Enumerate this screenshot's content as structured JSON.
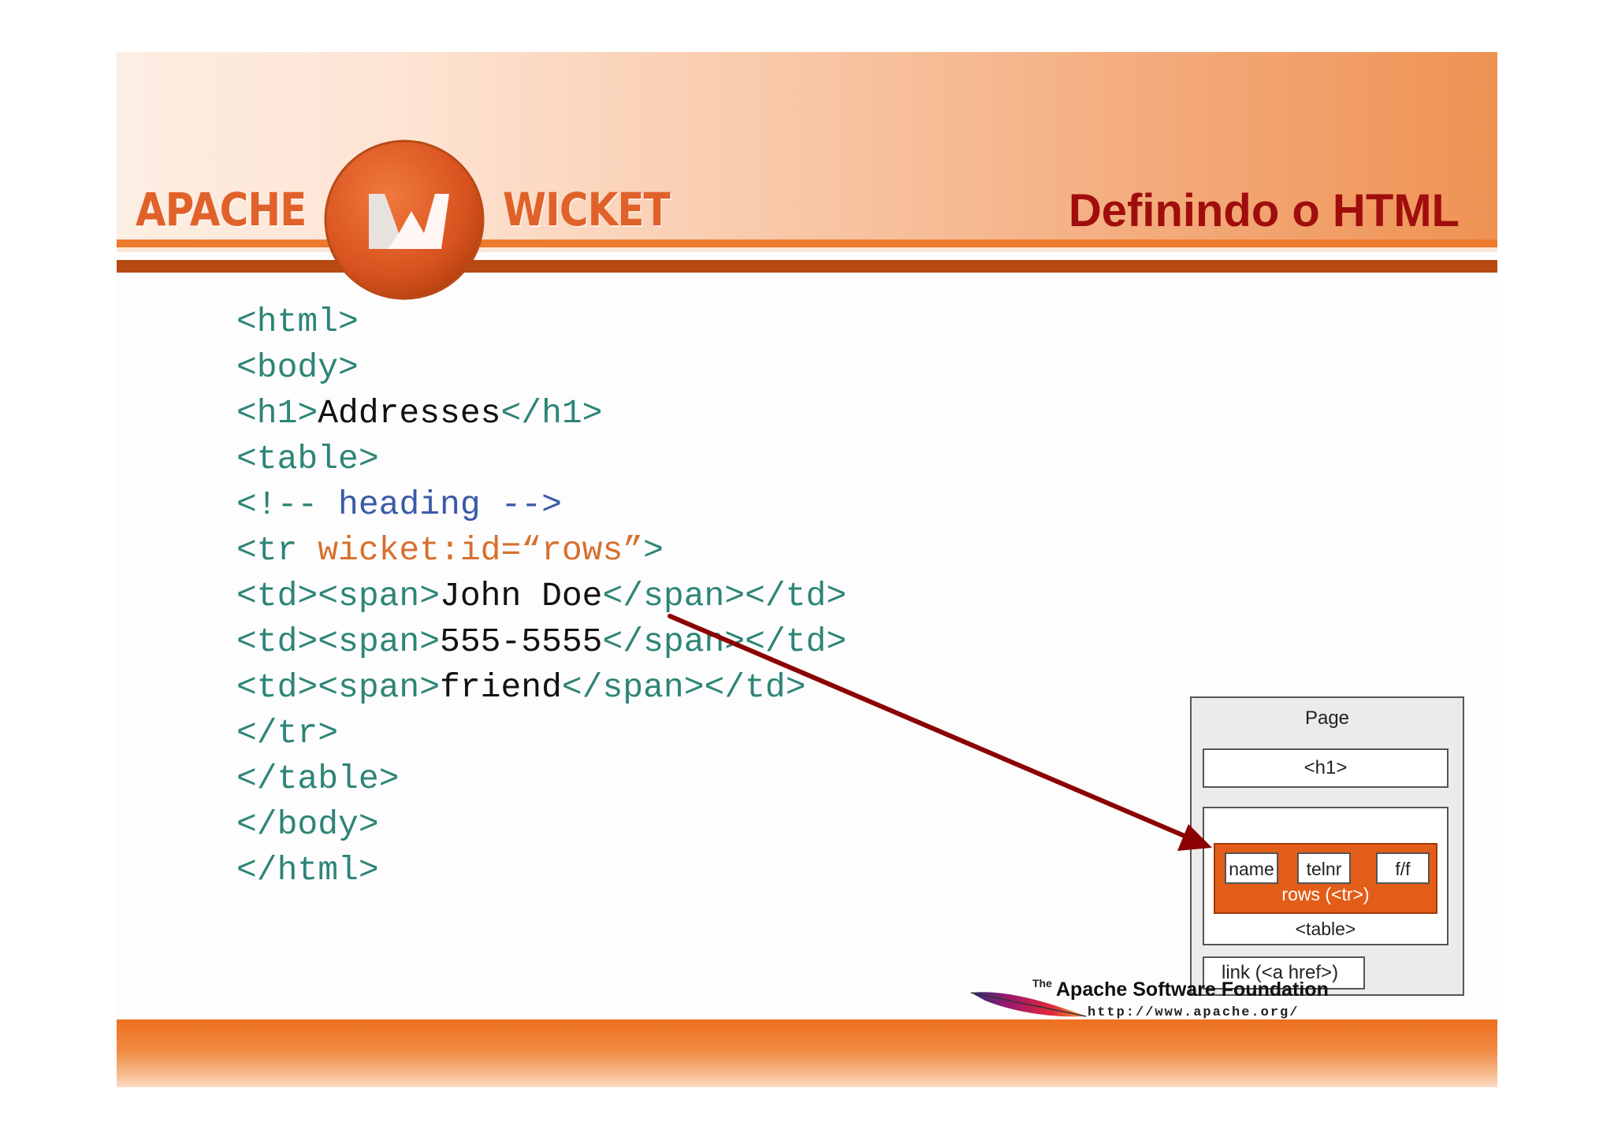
{
  "header": {
    "brand_left": "APACHE",
    "brand_right": "WICKET",
    "logo_letter": "W",
    "title": "Definindo o HTML"
  },
  "code": {
    "lines": [
      [
        {
          "t": "<html>",
          "k": "tag"
        }
      ],
      [
        {
          "t": "<body>",
          "k": "tag"
        }
      ],
      [
        {
          "t": "<h1>",
          "k": "tag"
        },
        {
          "t": "Addresses",
          "k": "txt"
        },
        {
          "t": "</h1>",
          "k": "tag"
        }
      ],
      [
        {
          "t": "<table>",
          "k": "tag"
        }
      ],
      [
        {
          "t": "<!-- ",
          "k": "tag"
        },
        {
          "t": "heading",
          "k": "cmt"
        },
        {
          "t": " -->",
          "k": "cmt"
        }
      ],
      [
        {
          "t": "<tr ",
          "k": "tag"
        },
        {
          "t": "wicket:id=“rows”",
          "k": "attr"
        },
        {
          "t": ">",
          "k": "tag"
        }
      ],
      [
        {
          "t": "<td><span>",
          "k": "tag"
        },
        {
          "t": "John Doe",
          "k": "txt"
        },
        {
          "t": "</span></td>",
          "k": "tag"
        }
      ],
      [
        {
          "t": "<td><span>",
          "k": "tag"
        },
        {
          "t": "555-5555",
          "k": "txt"
        },
        {
          "t": "</span></td>",
          "k": "tag"
        }
      ],
      [
        {
          "t": "<td><span>",
          "k": "tag"
        },
        {
          "t": "friend",
          "k": "txt"
        },
        {
          "t": "</span></td>",
          "k": "tag"
        }
      ],
      [
        {
          "t": "</tr>",
          "k": "tag"
        }
      ],
      [
        {
          "t": "</table>",
          "k": "tag"
        }
      ],
      [
        {
          "t": "</body>",
          "k": "tag"
        }
      ],
      [
        {
          "t": "</html>",
          "k": "tag"
        }
      ]
    ]
  },
  "diagram": {
    "page_label": "Page",
    "h1_label": "<h1>",
    "cells": [
      "name",
      "telnr",
      "f/f"
    ],
    "rows_label": "rows (<tr>)",
    "table_label": "<table>",
    "link_label": "link (<a href>)"
  },
  "footer": {
    "the": "The",
    "foundation": "Apache Software Foundation",
    "url": "http://www.apache.org/"
  },
  "colors": {
    "accent": "#ee7a2e",
    "title": "#a00d0d",
    "arrow": "#8b0000",
    "code_tag": "#2d8577",
    "code_attr": "#d86f2d",
    "code_comment": "#3a5aa8"
  }
}
